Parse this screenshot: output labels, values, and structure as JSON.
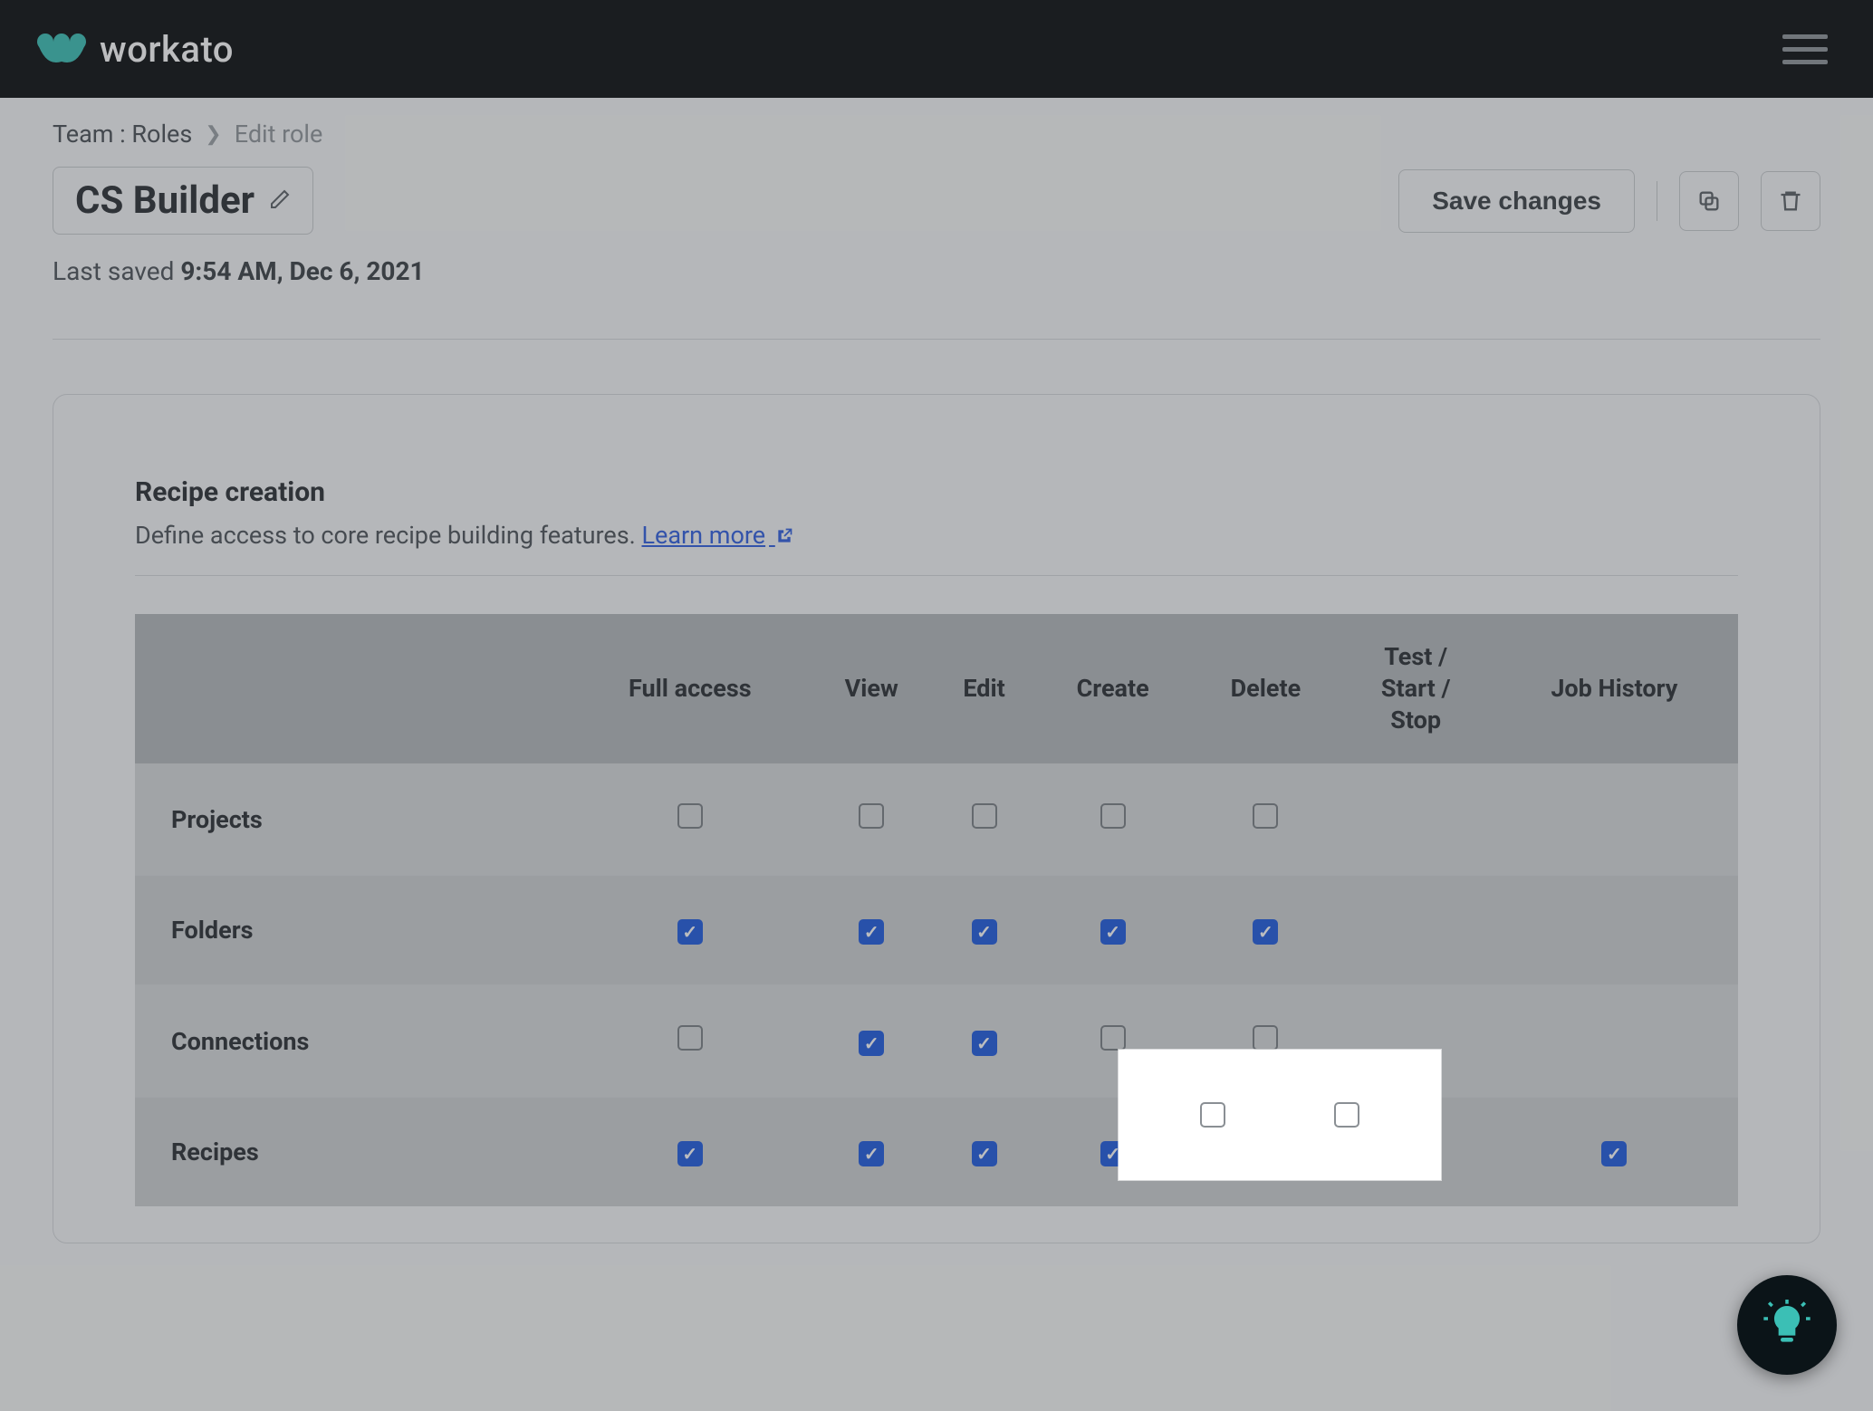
{
  "brand": {
    "name": "workato"
  },
  "breadcrumb": {
    "root": "Team : Roles",
    "current": "Edit role"
  },
  "title": "CS Builder",
  "saved": {
    "prefix": "Last saved",
    "timestamp": "9:54 AM, Dec 6, 2021"
  },
  "actions": {
    "save": "Save changes"
  },
  "section": {
    "title": "Recipe creation",
    "desc": "Define access to core recipe building features.",
    "learn_more": "Learn more"
  },
  "table": {
    "columns": [
      "",
      "Full access",
      "View",
      "Edit",
      "Create",
      "Delete",
      "Test / Start / Stop",
      "Job History"
    ],
    "rows": [
      {
        "label": "Projects",
        "cells": [
          false,
          false,
          false,
          false,
          false,
          null,
          null
        ]
      },
      {
        "label": "Folders",
        "cells": [
          true,
          true,
          true,
          true,
          true,
          null,
          null
        ]
      },
      {
        "label": "Connections",
        "cells": [
          false,
          true,
          true,
          false,
          false,
          null,
          null
        ]
      },
      {
        "label": "Recipes",
        "cells": [
          true,
          true,
          true,
          true,
          true,
          true,
          true
        ]
      }
    ]
  }
}
